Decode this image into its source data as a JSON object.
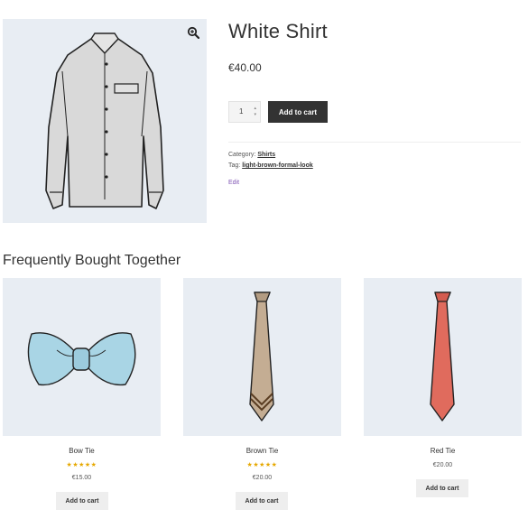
{
  "product": {
    "title": "White Shirt",
    "price": "€40.00",
    "quantity": "1",
    "add_to_cart": "Add to cart",
    "category_label": "Category:",
    "category": "Shirts",
    "tag_label": "Tag:",
    "tag": "light-brown-formal-look",
    "edit": "Edit"
  },
  "related": {
    "title": "Frequently Bought Together",
    "items": [
      {
        "name": "Bow Tie",
        "rating": "★★★★★",
        "price": "€15.00",
        "button": "Add to cart"
      },
      {
        "name": "Brown Tie",
        "rating": "★★★★★",
        "price": "€20.00",
        "button": "Add to cart"
      },
      {
        "name": "Red Tie",
        "price": "€20.00",
        "button": "Add to cart"
      }
    ]
  },
  "colors": {
    "accent": "#333333",
    "stars": "#e6a800",
    "edit_link": "#7f54b3",
    "image_bg": "#e8edf3"
  }
}
